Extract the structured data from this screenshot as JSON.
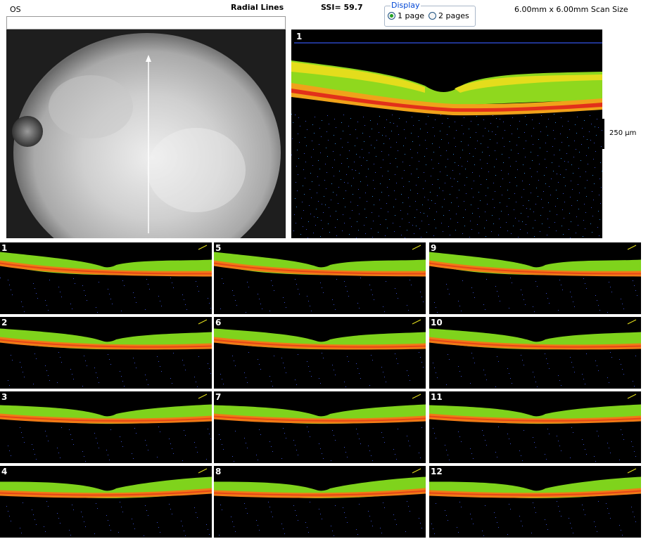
{
  "header": {
    "eye": "OS",
    "scan_pattern": "Radial Lines",
    "ssi": "SSI= 59.7",
    "scan_size": "6.00mm x 6.00mm Scan Size"
  },
  "display": {
    "legend": "Display",
    "options": [
      {
        "label": "1 page",
        "selected": true
      },
      {
        "label": "2 pages",
        "selected": false
      }
    ]
  },
  "main_scan": {
    "number": "1"
  },
  "scale": {
    "label": "250 µm"
  },
  "thumbnails": [
    {
      "number": "1"
    },
    {
      "number": "2"
    },
    {
      "number": "3"
    },
    {
      "number": "4"
    },
    {
      "number": "5"
    },
    {
      "number": "6"
    },
    {
      "number": "7"
    },
    {
      "number": "8"
    },
    {
      "number": "9"
    },
    {
      "number": "10"
    },
    {
      "number": "11"
    },
    {
      "number": "12"
    }
  ],
  "colors": {
    "retina_green": "#7fd31c",
    "retina_yellow": "#e6e01c",
    "rpe_orange": "#f07a16",
    "rpe_red": "#e2301a",
    "noise_blue": "#3a4fc8"
  }
}
